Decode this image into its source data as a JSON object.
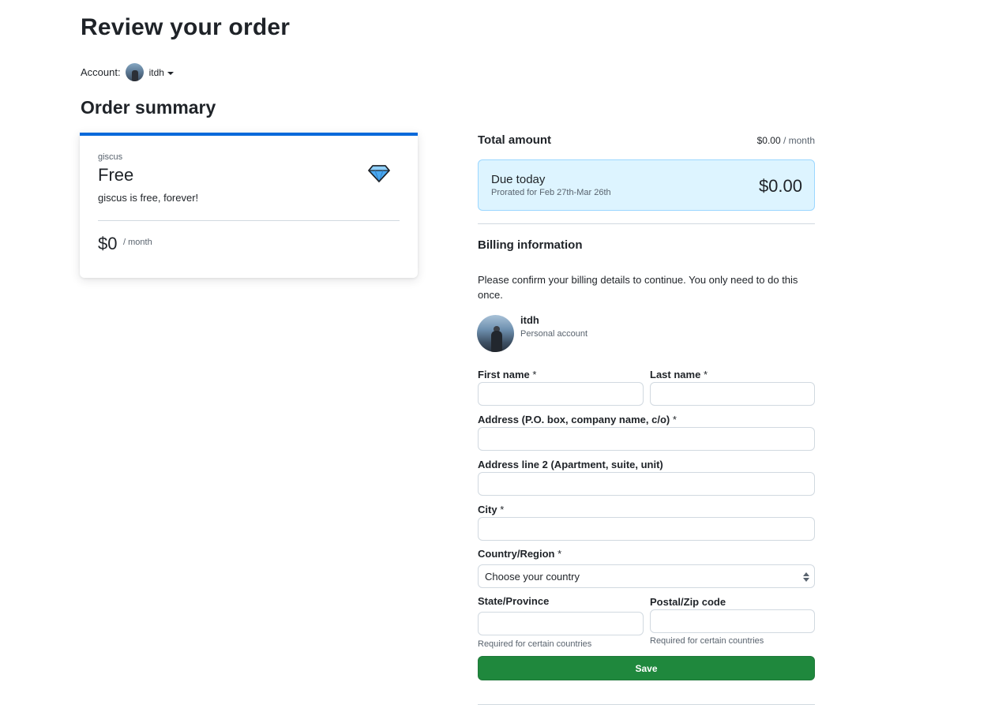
{
  "page": {
    "title": "Review your order"
  },
  "account": {
    "label": "Account:",
    "name": "itdh"
  },
  "order_summary": {
    "title": "Order summary",
    "plan": {
      "app": "giscus",
      "name": "Free",
      "description": "giscus is free, forever!",
      "price": "$0",
      "period": "/ month",
      "icon": "diamond-icon"
    }
  },
  "total": {
    "label": "Total amount",
    "amount": "$0.00",
    "period": "/ month"
  },
  "due": {
    "title": "Due today",
    "subtitle": "Prorated for Feb 27th-Mar 26th",
    "amount": "$0.00"
  },
  "billing": {
    "title": "Billing information",
    "note": "Please confirm your billing details to continue. You only need to do this once.",
    "owner_name": "itdh",
    "owner_type": "Personal account",
    "fields": {
      "first_name": {
        "label": "First name",
        "req": "*",
        "value": ""
      },
      "last_name": {
        "label": "Last name",
        "req": "*",
        "value": ""
      },
      "address1": {
        "label": "Address (P.O. box, company name, c/o)",
        "req": "*",
        "value": ""
      },
      "address2": {
        "label": "Address line 2 (Apartment, suite, unit)",
        "value": ""
      },
      "city": {
        "label": "City",
        "req": "*",
        "value": ""
      },
      "country": {
        "label": "Country/Region",
        "req": "*",
        "selected": "Choose your country"
      },
      "state": {
        "label": "State/Province",
        "value": "",
        "hint": "Required for certain countries"
      },
      "postal": {
        "label": "Postal/Zip code",
        "value": "",
        "hint": "Required for certain countries"
      }
    },
    "save_label": "Save"
  },
  "colors": {
    "accent": "#0969da",
    "save": "#1f883d",
    "due_bg": "#ddf4ff",
    "due_border": "#9cd7ff"
  }
}
